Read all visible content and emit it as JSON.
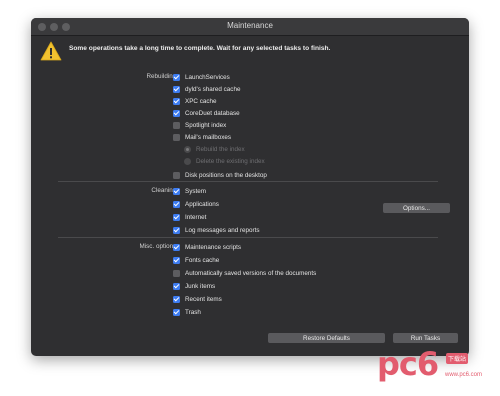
{
  "window": {
    "title": "Maintenance"
  },
  "warning": {
    "text": "Some operations take a long time to complete. Wait for any selected tasks to finish."
  },
  "rebuilding": {
    "label": "Rebuilding:",
    "items": [
      {
        "label": "LaunchServices",
        "checked": true
      },
      {
        "label": "dyld's shared cache",
        "checked": true
      },
      {
        "label": "XPC cache",
        "checked": true
      },
      {
        "label": "CoreDuet database",
        "checked": true
      },
      {
        "label": "Spotlight index",
        "checked": false
      },
      {
        "label": "Mail's mailboxes",
        "checked": false
      }
    ],
    "mail_options": [
      {
        "label": "Rebuild the index",
        "selected": true
      },
      {
        "label": "Delete the existing index",
        "selected": false
      }
    ],
    "disk_positions": {
      "label": "Disk positions on the desktop",
      "checked": false
    }
  },
  "cleaning": {
    "label": "Cleaning:",
    "items": [
      {
        "label": "System",
        "checked": true
      },
      {
        "label": "Applications",
        "checked": true
      },
      {
        "label": "Internet",
        "checked": true
      },
      {
        "label": "Log messages and reports",
        "checked": true
      }
    ],
    "options_button": "Options..."
  },
  "misc": {
    "label": "Misc. options:",
    "items": [
      {
        "label": "Maintenance scripts",
        "checked": true
      },
      {
        "label": "Fonts cache",
        "checked": true
      },
      {
        "label": "Automatically saved versions of the documents",
        "checked": false
      },
      {
        "label": "Junk items",
        "checked": true
      },
      {
        "label": "Recent items",
        "checked": true
      },
      {
        "label": "Trash",
        "checked": true
      }
    ]
  },
  "footer": {
    "restore_defaults": "Restore Defaults",
    "run_tasks": "Run Tasks"
  },
  "watermark": {
    "logo": "pc6",
    "badge": "下载站",
    "url": "www.pc6.com"
  }
}
